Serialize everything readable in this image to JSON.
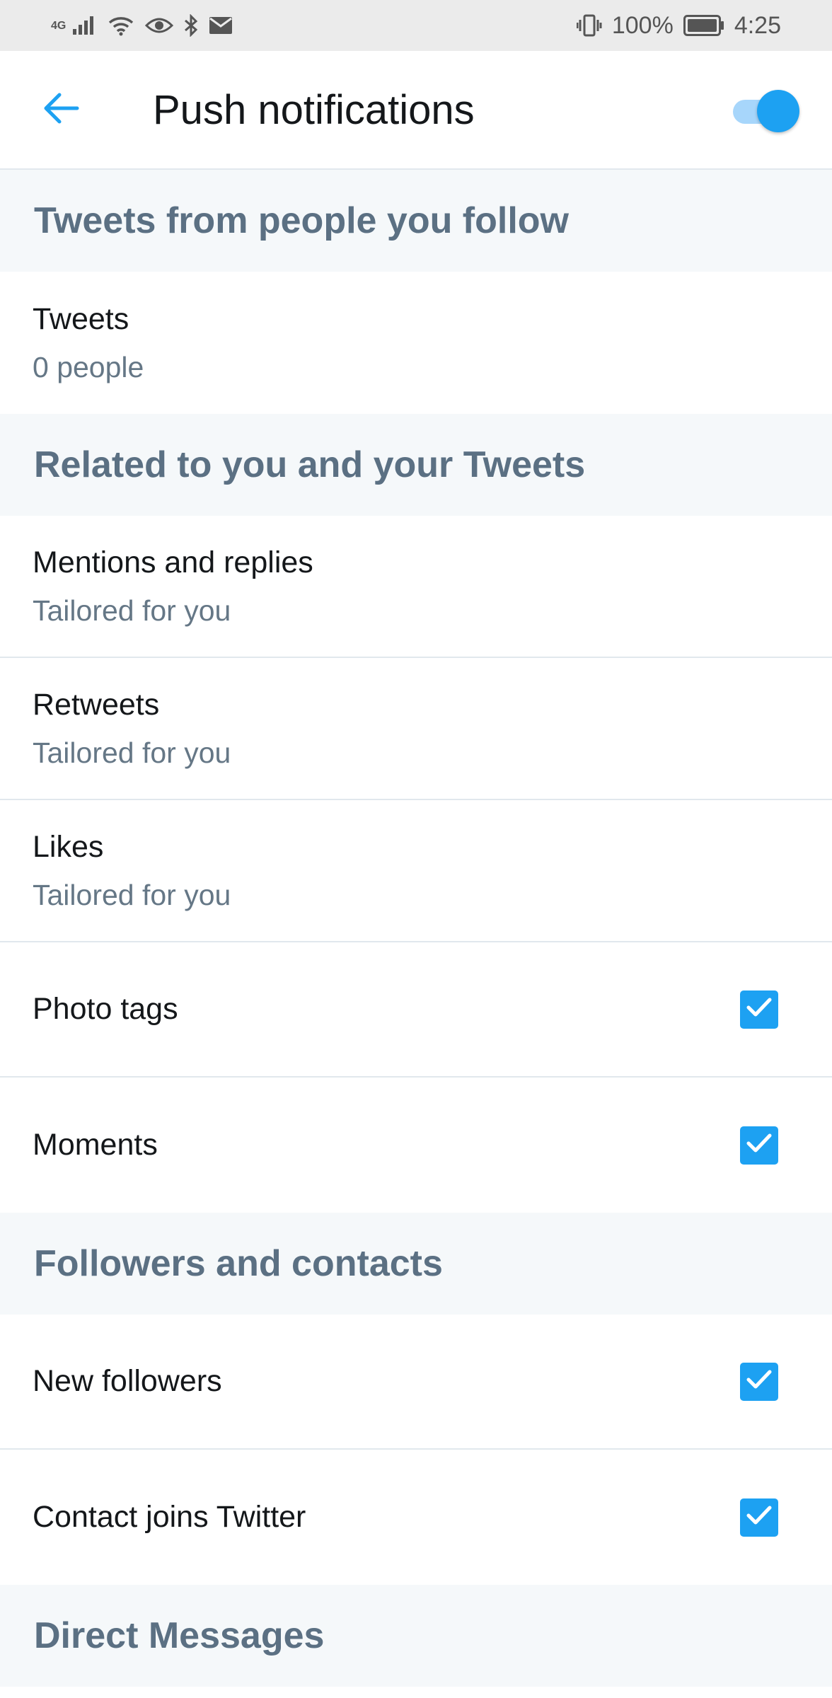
{
  "status_bar": {
    "network": "4G",
    "battery_percent": "100%",
    "time": "4:25"
  },
  "header": {
    "title": "Push notifications",
    "master_switch_on": true
  },
  "sections": {
    "tweets_from_follow": {
      "title": "Tweets from people you follow",
      "tweets": {
        "label": "Tweets",
        "sub": "0 people"
      }
    },
    "related": {
      "title": "Related to you and your Tweets",
      "mentions": {
        "label": "Mentions and replies",
        "sub": "Tailored for you"
      },
      "retweets": {
        "label": "Retweets",
        "sub": "Tailored for you"
      },
      "likes": {
        "label": "Likes",
        "sub": "Tailored for you"
      },
      "photo_tags": {
        "label": "Photo tags",
        "checked": true
      },
      "moments": {
        "label": "Moments",
        "checked": true
      }
    },
    "followers": {
      "title": "Followers and contacts",
      "new_followers": {
        "label": "New followers",
        "checked": true
      },
      "contact_joins": {
        "label": "Contact joins Twitter",
        "checked": true
      }
    },
    "direct_messages": {
      "title": "Direct Messages"
    }
  },
  "colors": {
    "accent": "#1da1f2",
    "section_bg": "#f5f8fa",
    "section_text": "#5b7083",
    "subtext": "#657786"
  }
}
